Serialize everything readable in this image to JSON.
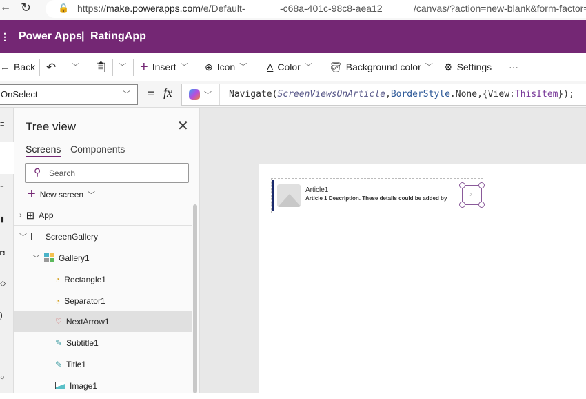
{
  "browser": {
    "url_prefix": "https://",
    "url_domain": "make.powerapps.com",
    "url_path": "/e/Default-",
    "url_mid": "-c68a-401c-98c8-aea12",
    "url_end": "/canvas/?action=new-blank&form-factor="
  },
  "appbar": {
    "product": "Power Apps",
    "separator": "|",
    "app_name": "RatingApp",
    "color": "#742774"
  },
  "toolbar": {
    "back": "Back",
    "insert": "Insert",
    "icon": "Icon",
    "color": "Color",
    "background_color": "Background color",
    "settings": "Settings",
    "more": "···"
  },
  "formula": {
    "property": "OnSelect",
    "equals": "=",
    "fx": "fx",
    "code": {
      "fn": "Navigate(",
      "arg1": "ScreenViewsOnArticle",
      "comma1": ",",
      "arg2": "BorderStyle",
      "dot": ".",
      "arg3": "None",
      "rest1": ",{",
      "key": "View",
      "colon": ":",
      "val": "ThisItem",
      "rest2": "});"
    }
  },
  "tree": {
    "title": "Tree view",
    "tabs": [
      "Screens",
      "Components"
    ],
    "search_placeholder": "Search",
    "new_screen": "New screen",
    "nodes": {
      "app": "App",
      "screen": "ScreenGallery",
      "gallery": "Gallery1",
      "rect": "Rectangle1",
      "sep": "Separator1",
      "arrow": "NextArrow1",
      "subtitle": "Subtitle1",
      "title": "Title1",
      "image": "Image1"
    }
  },
  "gallery": {
    "title": "Article1",
    "description": "Article 1 Description. These details could be added by"
  }
}
